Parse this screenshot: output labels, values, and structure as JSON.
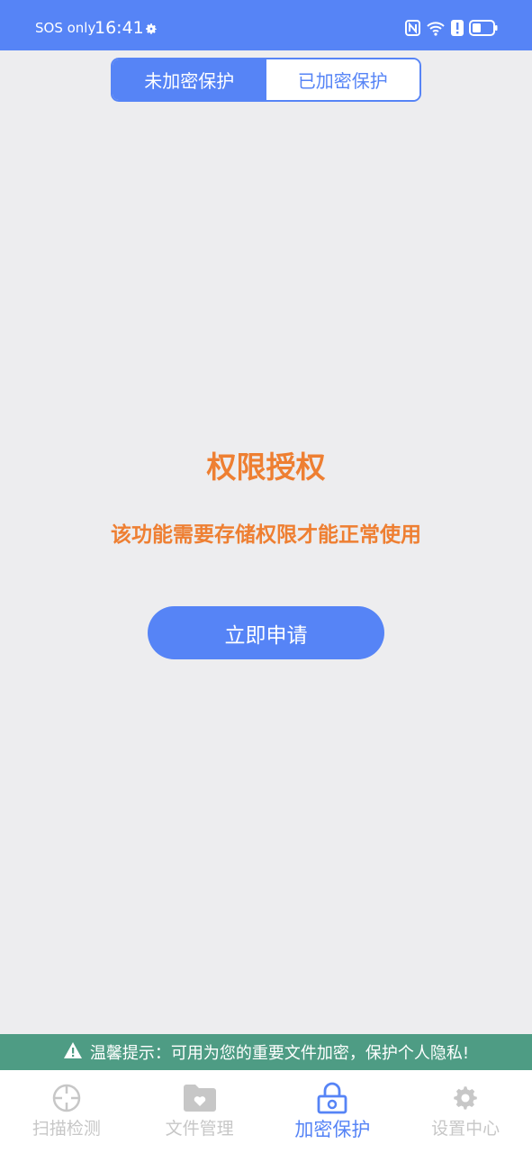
{
  "status_bar": {
    "carrier": "SOS only",
    "time": "16:41",
    "icons": [
      "settings-gear-icon",
      "nfc-icon",
      "wifi-icon",
      "alert-icon",
      "battery-icon"
    ]
  },
  "tabs": [
    {
      "label": "未加密保护",
      "active": true
    },
    {
      "label": "已加密保护",
      "active": false
    }
  ],
  "permission": {
    "title": "权限授权",
    "description": "该功能需要存储权限才能正常使用",
    "button_label": "立即申请"
  },
  "tip": {
    "icon": "warning-triangle-icon",
    "text": "温馨提示：可用为您的重要文件加密，保护个人隐私!"
  },
  "bottom_nav": [
    {
      "label": "扫描检测",
      "icon": "crosshair-icon",
      "active": false
    },
    {
      "label": "文件管理",
      "icon": "folder-heart-icon",
      "active": false
    },
    {
      "label": "加密保护",
      "icon": "lock-icon",
      "active": true
    },
    {
      "label": "设置中心",
      "icon": "gear-icon",
      "active": false
    }
  ],
  "colors": {
    "primary": "#5684f6",
    "warning_text": "#ee7f32",
    "tip_bar": "#4e9c84",
    "inactive_nav": "#c7c7c7",
    "background": "#ededef"
  }
}
